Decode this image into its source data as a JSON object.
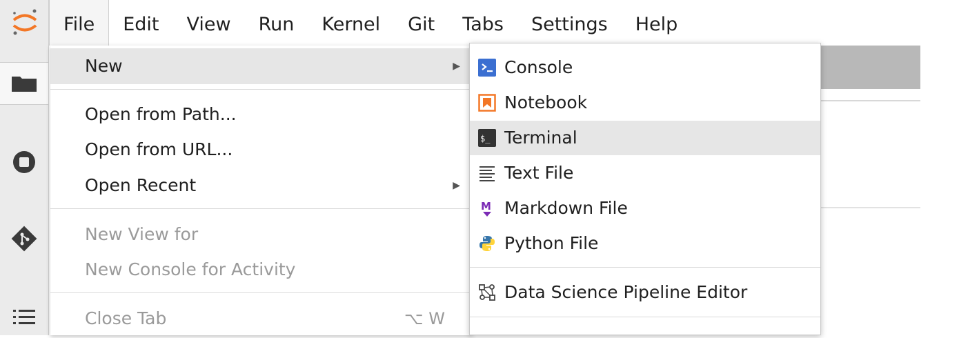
{
  "menubar": {
    "items": [
      {
        "label": "File",
        "active": true
      },
      {
        "label": "Edit"
      },
      {
        "label": "View"
      },
      {
        "label": "Run"
      },
      {
        "label": "Kernel"
      },
      {
        "label": "Git"
      },
      {
        "label": "Tabs"
      },
      {
        "label": "Settings"
      },
      {
        "label": "Help"
      }
    ]
  },
  "file_menu": {
    "items": [
      {
        "label": "New",
        "has_submenu": true,
        "active": true
      },
      {
        "label": "Open from Path..."
      },
      {
        "label": "Open from URL..."
      },
      {
        "label": "Open Recent",
        "has_submenu": true
      },
      {
        "label": "New View for",
        "disabled": true
      },
      {
        "label": "New Console for Activity",
        "disabled": true
      },
      {
        "label": "Close Tab",
        "disabled": true,
        "shortcut": "⌥ W"
      }
    ]
  },
  "new_submenu": {
    "items": [
      {
        "label": "Console",
        "icon": "console-icon"
      },
      {
        "label": "Notebook",
        "icon": "notebook-icon"
      },
      {
        "label": "Terminal",
        "icon": "terminal-icon",
        "active": true
      },
      {
        "label": "Text File",
        "icon": "text-file-icon"
      },
      {
        "label": "Markdown File",
        "icon": "markdown-icon"
      },
      {
        "label": "Python File",
        "icon": "python-icon"
      },
      {
        "label": "Data Science Pipeline Editor",
        "icon": "pipeline-icon"
      }
    ]
  },
  "sidebar": {
    "icons": [
      "jupyter-logo-icon",
      "folder-icon",
      "running-stop-icon",
      "git-icon",
      "table-of-contents-icon"
    ]
  },
  "colors": {
    "accent_orange": "#f37726",
    "console_blue": "#3b6fd1",
    "markdown_purple": "#7b2bb5",
    "active_bg": "#e6e6e6",
    "disabled_text": "#9a9a9a"
  }
}
